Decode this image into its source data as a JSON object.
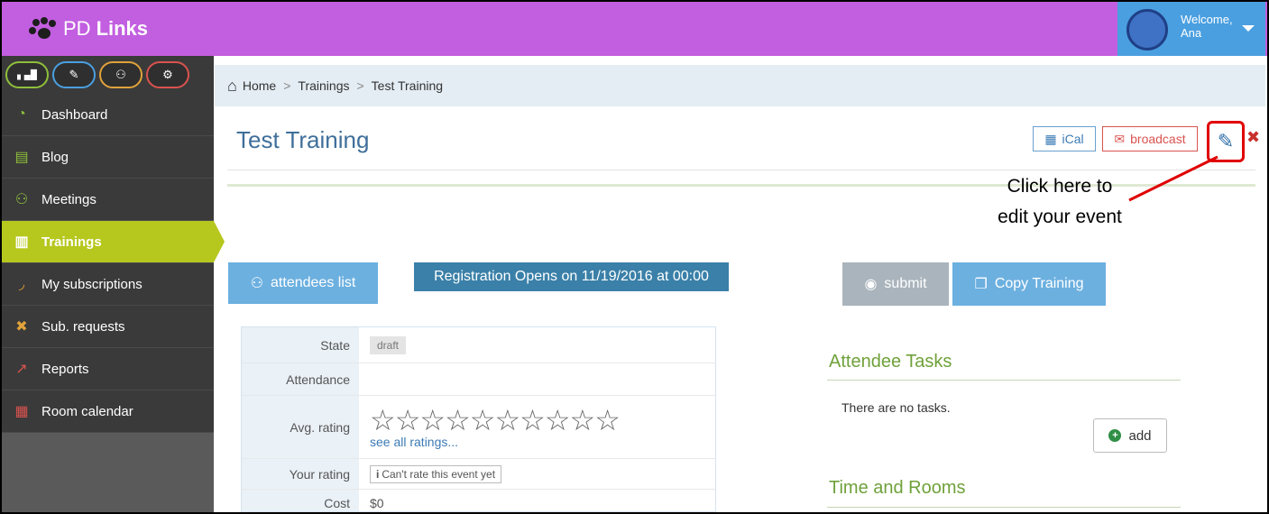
{
  "brand": {
    "prefix": "PD",
    "name": "Links"
  },
  "user": {
    "welcome": "Welcome,",
    "name": "Ana"
  },
  "quick_actions": [
    {
      "icon": "signal-icon",
      "glyph": "▖▄█",
      "ring": "#8fbf3b"
    },
    {
      "icon": "pencil-icon",
      "glyph": "✎",
      "ring": "#4a9fe0"
    },
    {
      "icon": "group-icon",
      "glyph": "⚇",
      "ring": "#e0a23a"
    },
    {
      "icon": "cogs-icon",
      "glyph": "⚙",
      "ring": "#d9534f"
    }
  ],
  "sidebar": {
    "items": [
      {
        "label": "Dashboard",
        "icon": "dashboard-icon",
        "glyph": "◔",
        "color": "#8fbf3b"
      },
      {
        "label": "Blog",
        "icon": "newspaper-icon",
        "glyph": "▤",
        "color": "#8fbf3b"
      },
      {
        "label": "Meetings",
        "icon": "group-icon",
        "glyph": "⚇",
        "color": "#8fbf3b"
      },
      {
        "label": "Trainings",
        "icon": "book-icon",
        "glyph": "▥",
        "color": "#ffffff"
      },
      {
        "label": "My subscriptions",
        "icon": "rss-icon",
        "glyph": "◞",
        "color": "#e0a23a"
      },
      {
        "label": "Sub. requests",
        "icon": "user-times-icon",
        "glyph": "✖",
        "color": "#e0a23a"
      },
      {
        "label": "Reports",
        "icon": "line-chart-icon",
        "glyph": "↗",
        "color": "#d9534f"
      },
      {
        "label": "Room calendar",
        "icon": "calendar-icon",
        "glyph": "▦",
        "color": "#d9534f"
      }
    ]
  },
  "breadcrumb": {
    "home": "Home",
    "section": "Trainings",
    "current": "Test Training"
  },
  "page": {
    "title": "Test Training"
  },
  "toolbar": {
    "ical": "iCal",
    "broadcast": "broadcast"
  },
  "callout": {
    "line1": "Click here to",
    "line2": "edit your event"
  },
  "actions": {
    "attendees": "attendees list",
    "registration": "Registration Opens on 11/19/2016 at 00:00",
    "submit": "submit",
    "copy": "Copy Training"
  },
  "details": {
    "state_label": "State",
    "state_value": "draft",
    "attendance_label": "Attendance",
    "attendance_value": "",
    "rating_label": "Avg. rating",
    "rating_stars": "☆☆☆☆☆☆☆☆☆☆",
    "rating_value": 0,
    "see_all": "see all ratings...",
    "your_rating_label": "Your rating",
    "your_rating_value": "Can't rate this event yet",
    "cost_label": "Cost",
    "cost_value": "$0"
  },
  "tasks": {
    "title": "Attendee Tasks",
    "empty": "There are no tasks.",
    "add": "add"
  },
  "rooms": {
    "title": "Time and Rooms"
  }
}
